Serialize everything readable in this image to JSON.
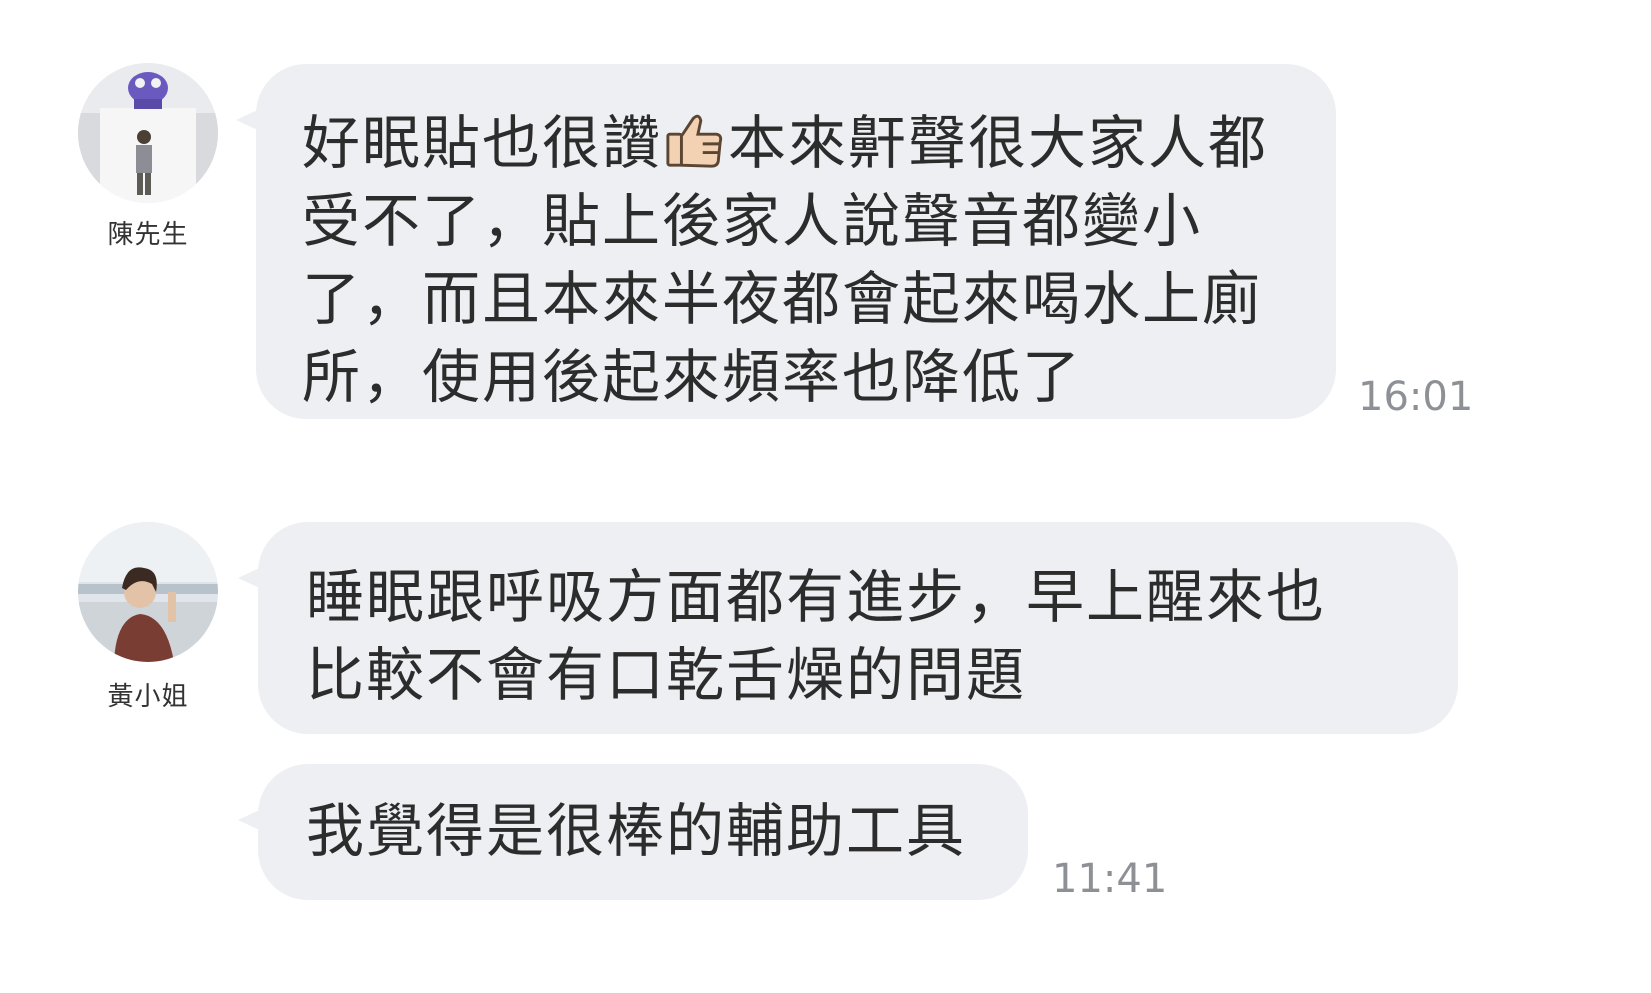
{
  "messages": [
    {
      "sender": "陳先生",
      "avatar_icon": "user-avatar-photo",
      "lines_before_emoji": "好眠貼也很讚",
      "emoji_icon": "thumbs-up-icon",
      "line1_after_emoji": "本來鼾聲很大家人都",
      "lines": [
        "受不了，貼上後家人說聲音都變小",
        "了，而且本來半夜都會起來喝水上廁",
        "所，使用後起來頻率也降低了"
      ],
      "time": "16:01"
    },
    {
      "sender": "黃小姐",
      "avatar_icon": "user-avatar-photo",
      "bubbles": [
        {
          "lines": [
            "睡眠跟呼吸方面都有進步，早上醒來也",
            "比較不會有口乾舌燥的問題"
          ]
        },
        {
          "lines": [
            "我覺得是很棒的輔助工具"
          ]
        }
      ],
      "time": "11:41"
    }
  ],
  "colors": {
    "bubble": "#eeeff2",
    "text": "#2c2c2c",
    "timestamp": "#8d9196"
  }
}
